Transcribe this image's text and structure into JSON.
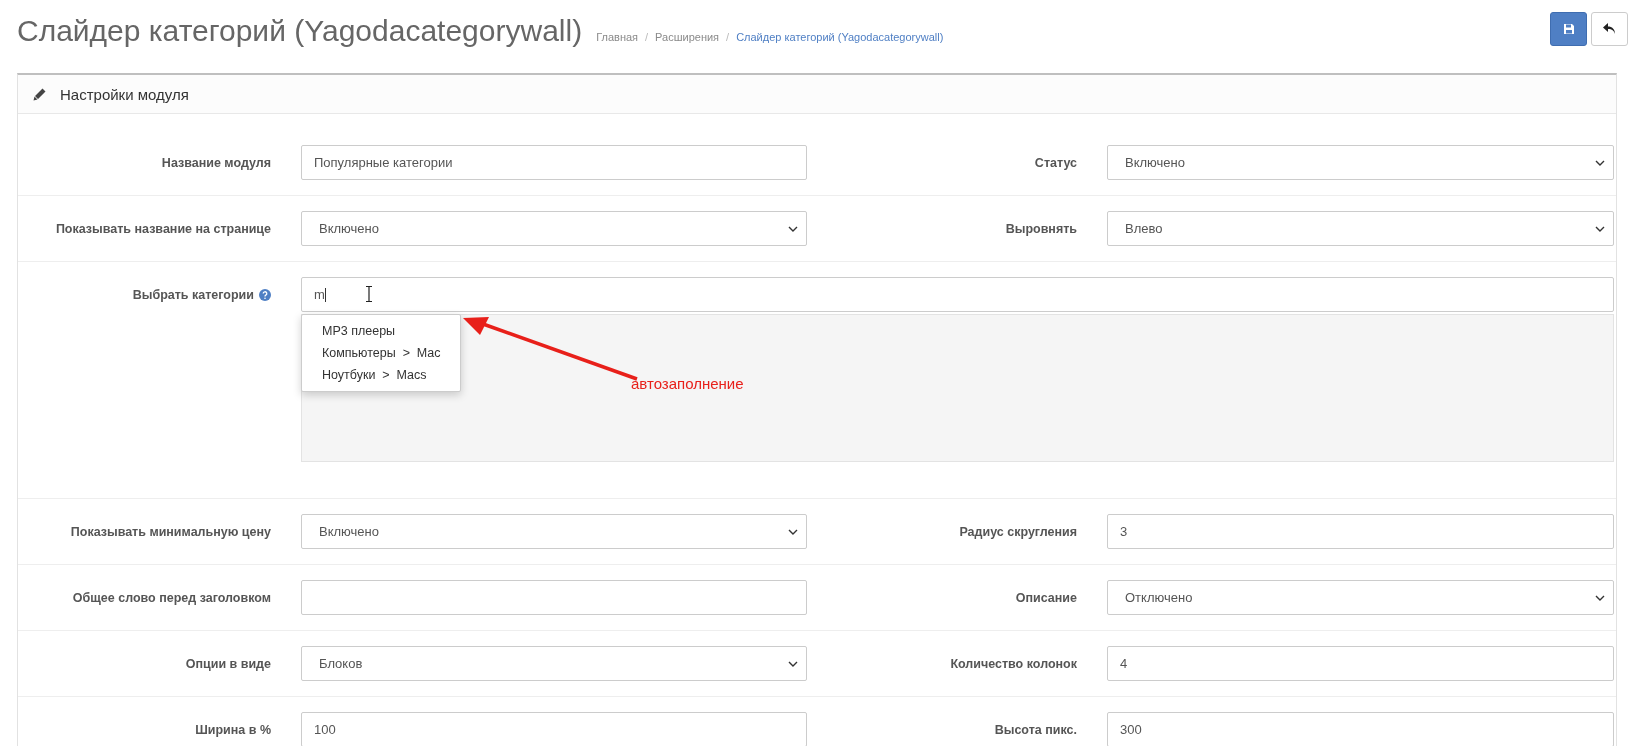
{
  "page": {
    "title": "Слайдер категорий (Yagodacategorywall)",
    "breadcrumb_separator": "/",
    "breadcrumb": [
      {
        "label": "Главная",
        "active": false
      },
      {
        "label": "Расширения",
        "active": false
      },
      {
        "label": "Слайдер категорий (Yagodacategorywall)",
        "active": true
      }
    ]
  },
  "panel": {
    "title": "Настройки модуля",
    "rows": [
      {
        "fields": [
          {
            "kind": "text",
            "label": "Название модуля",
            "value": "Популярные категории"
          },
          {
            "kind": "select",
            "label": "Статус",
            "value": "Включено"
          }
        ]
      },
      {
        "fields": [
          {
            "kind": "select",
            "label": "Показывать название на странице",
            "value": "Включено"
          },
          {
            "kind": "select",
            "label": "Выровнять",
            "value": "Влево"
          }
        ]
      },
      {
        "fields": [
          {
            "kind": "autocomplete",
            "label": "Выбрать категории",
            "help": true,
            "value": "m",
            "suggestions": [
              "MP3 плееры",
              "Компьютеры  >  Mac",
              "Ноутбуки  >  Macs"
            ],
            "annotation": "автозаполнение"
          }
        ]
      },
      {
        "fields": [
          {
            "kind": "select",
            "label": "Показывать минимальную цену",
            "value": "Включено"
          },
          {
            "kind": "text",
            "label": "Радиус скругления",
            "value": "3"
          }
        ]
      },
      {
        "fields": [
          {
            "kind": "text",
            "label": "Общее слово перед заголовком"
          },
          {
            "kind": "select",
            "label": "Описание",
            "value": "Отключено"
          }
        ]
      },
      {
        "fields": [
          {
            "kind": "select",
            "label": "Опции в виде",
            "value": "Блоков"
          },
          {
            "kind": "text",
            "label": "Количество колонок",
            "value": "4"
          }
        ]
      },
      {
        "fields": [
          {
            "kind": "text",
            "label": "Ширина в %",
            "value": "100"
          },
          {
            "kind": "text",
            "label": "Высота пикс.",
            "value": "300"
          }
        ]
      }
    ]
  }
}
